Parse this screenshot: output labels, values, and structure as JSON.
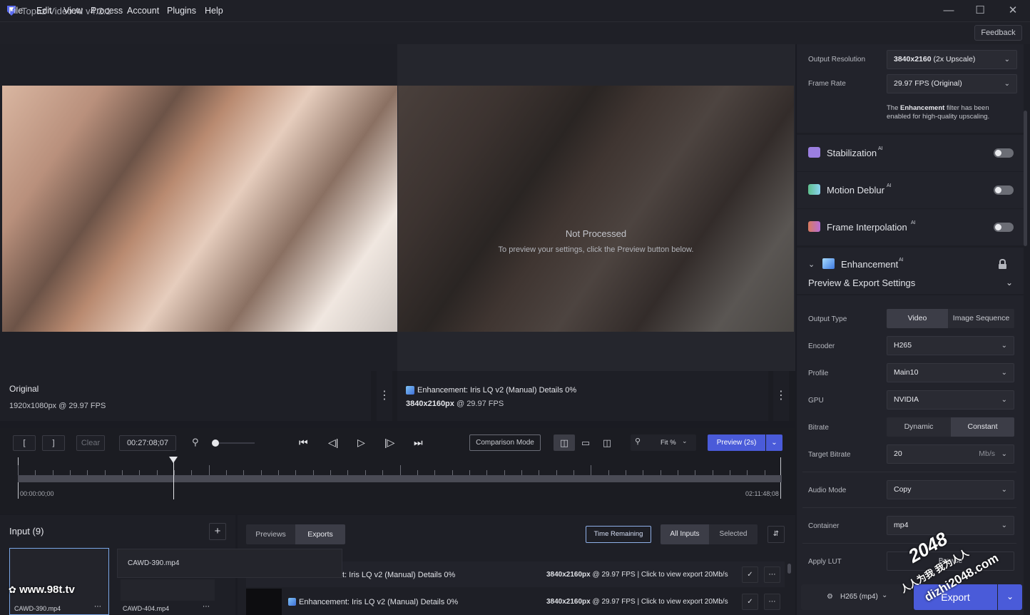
{
  "window": {
    "title": "Topaz Video AI  v4.2.1"
  },
  "menu": {
    "items": [
      "File",
      "Edit",
      "View",
      "Process",
      "Account",
      "Plugins",
      "Help"
    ],
    "feedback": "Feedback"
  },
  "viewer": {
    "not_processed_title": "Not Processed",
    "not_processed_sub": "To preview your settings, click the Preview button below.",
    "left_label": "Original",
    "left_info": "1920x1080px @ 29.97 FPS",
    "right_label": "Enhancement: Iris LQ v2 (Manual) Details 0%",
    "right_res": "3840x2160px",
    "right_fps": "@ 29.97 FPS"
  },
  "controls": {
    "in_mark": "[",
    "out_mark": "]",
    "clear": "Clear",
    "timecode": "00:27:08;07",
    "comparison_mode": "Comparison Mode",
    "zoom": "Fit %",
    "preview": "Preview (2s)",
    "start_time": "00:00:00;00",
    "end_time": "02:11:48;08",
    "playhead_fraction": 0.204
  },
  "sidebar": {
    "output_resolution_label": "Output Resolution",
    "output_resolution_bold": "3840x2160",
    "output_resolution_rest": " (2x Upscale)",
    "frame_rate_label": "Frame Rate",
    "frame_rate": "29.97 FPS (Original)",
    "note_pre": "The ",
    "note_bold": "Enhancement",
    "note_post": " filter has been",
    "note_line2": "enabled for high-quality upscaling.",
    "features": [
      {
        "label": "Stabilization",
        "sup": "AI",
        "color": "#9b7fe0"
      },
      {
        "label": "Motion Deblur",
        "sup": "AI",
        "color": "#5fbf8d"
      },
      {
        "label": "Frame Interpolation",
        "sup": "AI",
        "color": "#d97a5e"
      }
    ],
    "enhancement_label": "Enhancement",
    "enhancement_sup": "AI",
    "preview_export_label": "Preview & Export Settings",
    "output_type_label": "Output Type",
    "output_type_video": "Video",
    "output_type_seq": "Image Sequence",
    "encoder_label": "Encoder",
    "encoder": "H265",
    "profile_label": "Profile",
    "profile": "Main10",
    "gpu_label": "GPU",
    "gpu": "NVIDIA",
    "bitrate_label": "Bitrate",
    "bitrate_dynamic": "Dynamic",
    "bitrate_constant": "Constant",
    "target_bitrate_label": "Target Bitrate",
    "target_bitrate": "20",
    "target_bitrate_unit": "Mb/s",
    "audio_mode_label": "Audio Mode",
    "audio_mode": "Copy",
    "container_label": "Container",
    "container": "mp4",
    "apply_lut_label": "Apply LUT",
    "apply_lut_btn": "Browse",
    "export_format": "H265 (mp4)",
    "export": "Export"
  },
  "inputs": {
    "title": "Input (9)",
    "files": [
      "CAWD-390.mp4",
      "CAWD-404.mp4"
    ],
    "tooltip": "CAWD-390.mp4"
  },
  "exports": {
    "tab_previews": "Previews",
    "tab_exports": "Exports",
    "time_remaining": "Time Remaining",
    "all_inputs": "All Inputs",
    "selected": "Selected",
    "rows": [
      {
        "name": "t: Iris LQ v2 (Manual) Details 0%",
        "res": "3840x2160px",
        "fps": "@ 29.97 FPS",
        "link": "|  Click to view export",
        "rate": "20Mb/s"
      },
      {
        "name": "Enhancement: Iris LQ v2 (Manual) Details 0%",
        "res": "3840x2160px",
        "fps": "@ 29.97 FPS",
        "link": "|  Click to view export",
        "rate": "20Mb/s"
      }
    ]
  },
  "watermarks": {
    "site1": "www.98t.tv",
    "site2a": "2048",
    "site2b": "人人为我 我为人人",
    "site2c": "dizhi2048.com"
  }
}
